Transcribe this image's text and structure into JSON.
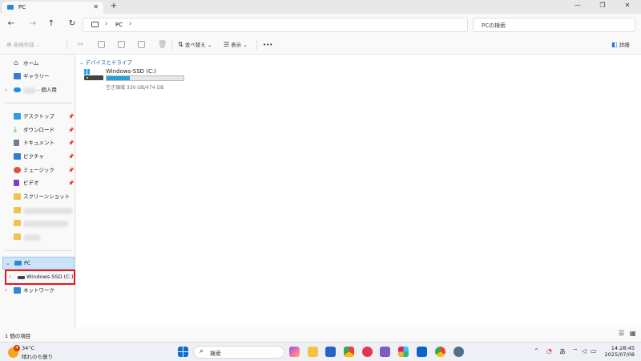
{
  "window": {
    "tab_title": "PC",
    "tab_close": "✕",
    "new_tab": "+",
    "minimize": "—",
    "maximize": "❐",
    "close": "✕"
  },
  "nav": {
    "back": "←",
    "forward": "→",
    "up": "↑",
    "refresh": "↻",
    "breadcrumb": "PC",
    "chevron": "›",
    "search_placeholder": "PCの検索"
  },
  "toolbar": {
    "new": "新規作成",
    "new_chevron": "⌄",
    "sort": "並べ替え",
    "view": "表示",
    "more": "•••",
    "details": "詳細"
  },
  "sidebar": {
    "home": "ホーム",
    "gallery": "ギャラリー",
    "personal": "- 個人用",
    "desktop": "デスクトップ",
    "downloads": "ダウンロード",
    "documents": "ドキュメント",
    "pictures": "ピクチャ",
    "music": "ミュージック",
    "videos": "ビデオ",
    "screenshots": "スクリーンショット",
    "pc": "PC",
    "drive": "Windows-SSD (C:)",
    "network": "ネットワーク",
    "pin": "📌",
    "expand": "›",
    "collapse": "⌄"
  },
  "main": {
    "group_label": "デバイスとドライブ",
    "group_chevron": "⌄",
    "drive": {
      "name": "Windows-SSD (C:)",
      "free_text": "空き領域 330 GB/474 GB",
      "used_fraction": 0.3
    }
  },
  "status": {
    "item_count": "1 個の項目"
  },
  "taskbar": {
    "weather_temp": "34°C",
    "weather_desc": "晴れのち曇り",
    "weather_badge": "4",
    "search_label": "検索",
    "ime": "あ",
    "time": "14:28:45",
    "date": "2025/07/08"
  },
  "colors": {
    "accent": "#26a0da",
    "selection": "#cce4f7",
    "highlight_box": "#e8161b"
  }
}
